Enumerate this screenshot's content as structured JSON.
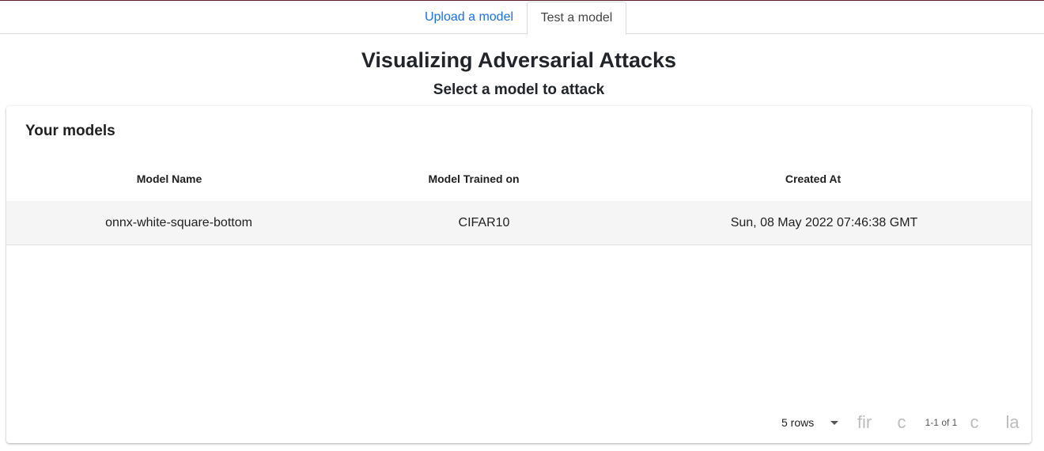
{
  "tabs": {
    "upload_label": "Upload a model",
    "test_label": "Test a model"
  },
  "header": {
    "title": "Visualizing Adversarial Attacks",
    "subtitle": "Select a model to attack"
  },
  "models_card": {
    "title": "Your models",
    "columns": [
      "Model Name",
      "Model Trained on",
      "Created At"
    ],
    "rows": [
      {
        "name": "onnx-white-square-bottom",
        "dataset": "CIFAR10",
        "created_at": "Sun, 08 May 2022 07:46:38 GMT"
      }
    ],
    "pagination": {
      "rows_per_page": "5 rows",
      "range": "1-1 of 1",
      "first_icon": "fir",
      "prev_icon": "c",
      "next_icon": "c",
      "last_icon": "la"
    }
  },
  "colors": {
    "accent_link": "#1a73e8",
    "top_bar": "#5a1f2a",
    "row_highlight": "#f5f5f5"
  }
}
